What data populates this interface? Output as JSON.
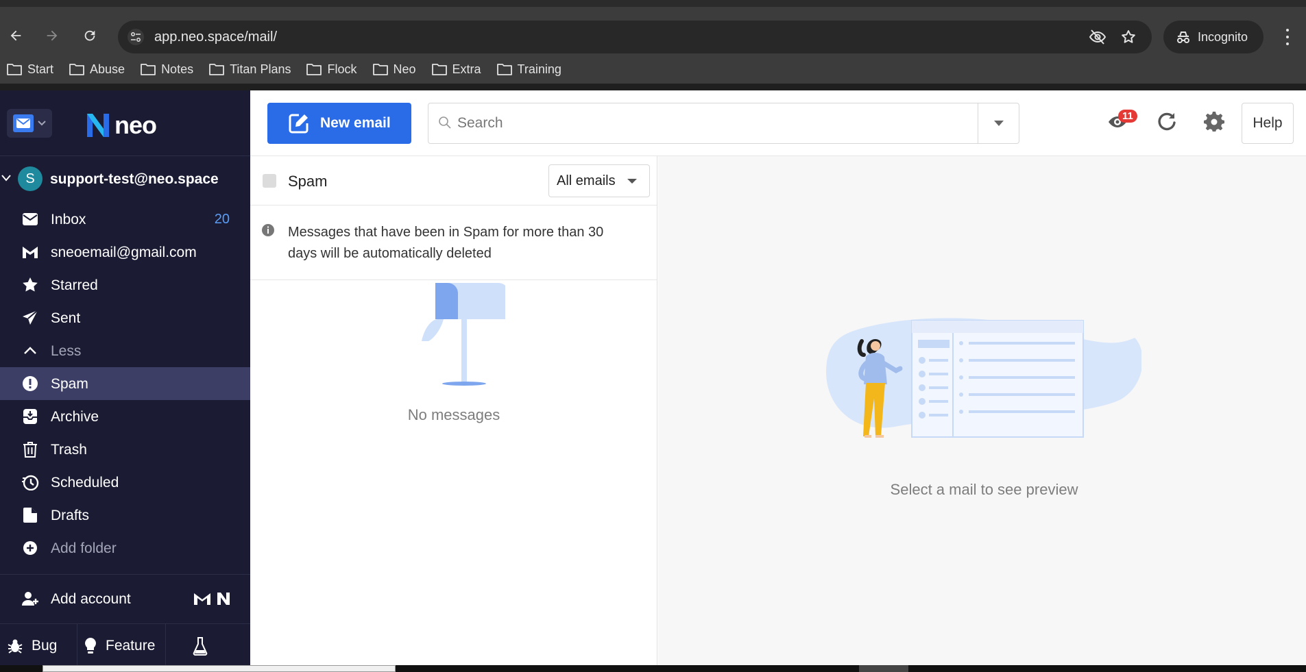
{
  "browser": {
    "url": "app.neo.space/mail/",
    "profile_label": "Incognito",
    "bookmarks": [
      "Start",
      "Abuse",
      "Notes",
      "Titan Plans",
      "Flock",
      "Neo",
      "Extra",
      "Training"
    ]
  },
  "app": {
    "logo_text": "neo",
    "new_email_label": "New email",
    "search_placeholder": "Search",
    "notification_count": "11",
    "help_label": "Help"
  },
  "sidebar": {
    "account_email": "support-test@neo.space",
    "account_initial": "S",
    "folders": [
      {
        "label": "Inbox",
        "count": "20",
        "icon": "envelope-icon"
      },
      {
        "label": "sneoemail@gmail.com",
        "count": "",
        "icon": "gmail-icon"
      },
      {
        "label": "Starred",
        "count": "",
        "icon": "star-icon"
      },
      {
        "label": "Sent",
        "count": "",
        "icon": "paper-plane-icon"
      },
      {
        "label": "Less",
        "count": "",
        "icon": "chevron-up-icon"
      },
      {
        "label": "Spam",
        "count": "",
        "icon": "alert-circle-icon"
      },
      {
        "label": "Archive",
        "count": "",
        "icon": "archive-icon"
      },
      {
        "label": "Trash",
        "count": "",
        "icon": "trash-icon"
      },
      {
        "label": "Scheduled",
        "count": "",
        "icon": "clock-icon"
      },
      {
        "label": "Drafts",
        "count": "",
        "icon": "draft-icon"
      },
      {
        "label": "Add folder",
        "count": "",
        "icon": "plus-circle-icon"
      }
    ],
    "active_folder": "Spam",
    "add_account_label": "Add account",
    "bug_label": "Bug",
    "feature_label": "Feature"
  },
  "list": {
    "title": "Spam",
    "filter_label": "All emails",
    "notice": "Messages that have been in Spam for more than 30 days will be automatically deleted",
    "empty_message": "No messages"
  },
  "preview": {
    "empty_message": "Select a mail to see preview"
  },
  "colors": {
    "sidebar_bg": "#1b1c33",
    "active_folder_bg": "#3c3e66",
    "primary_button": "#2a6be8",
    "count_color": "#5b9cf5",
    "badge": "#e53935"
  }
}
